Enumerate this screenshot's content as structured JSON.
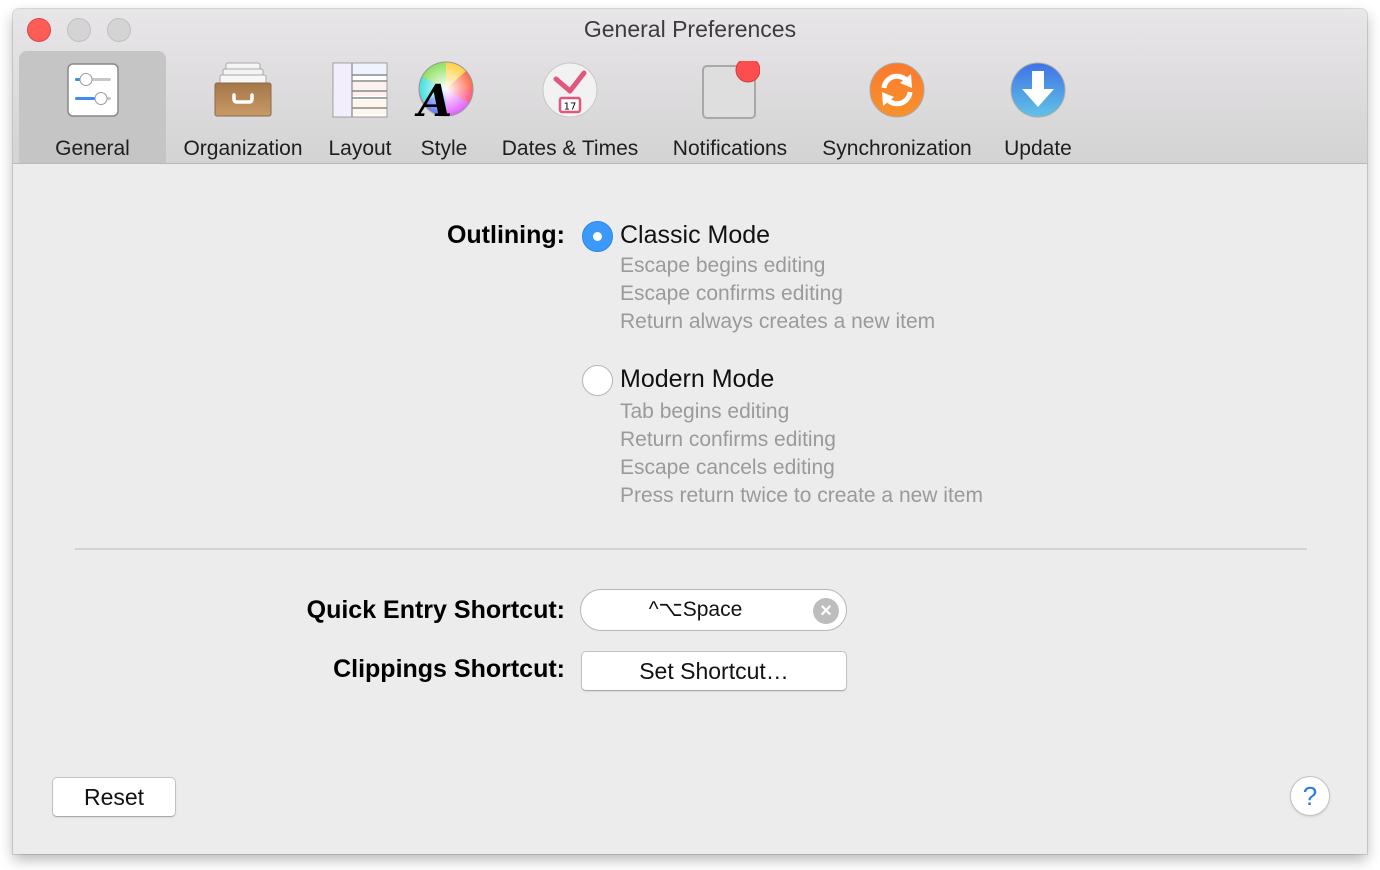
{
  "window": {
    "title": "General Preferences",
    "controls": [
      "close",
      "minimize",
      "zoom"
    ]
  },
  "toolbar": {
    "selected": "General",
    "items": [
      {
        "label": "General",
        "icon": "sliders-icon"
      },
      {
        "label": "Organization",
        "icon": "card-drawer-icon"
      },
      {
        "label": "Layout",
        "icon": "layout-grid-icon"
      },
      {
        "label": "Style",
        "icon": "color-wheel-font-icon"
      },
      {
        "label": "Dates & Times",
        "icon": "clock-calendar-icon",
        "badge_text": "17"
      },
      {
        "label": "Notifications",
        "icon": "notification-badge-icon"
      },
      {
        "label": "Synchronization",
        "icon": "sync-icon"
      },
      {
        "label": "Update",
        "icon": "download-arrow-icon"
      }
    ]
  },
  "outlining": {
    "label": "Outlining:",
    "selected": "Classic Mode",
    "options": [
      {
        "title": "Classic Mode",
        "checked": true,
        "descriptions": [
          "Escape begins editing",
          "Escape confirms editing",
          "Return always creates a new item"
        ]
      },
      {
        "title": "Modern Mode",
        "checked": false,
        "descriptions": [
          "Tab begins editing",
          "Return confirms editing",
          "Escape cancels editing",
          "Press return twice to create a new item"
        ]
      }
    ]
  },
  "shortcuts": {
    "quick_entry_label": "Quick Entry Shortcut:",
    "quick_entry_value": "^⌥Space",
    "clippings_label": "Clippings Shortcut:",
    "clippings_button": "Set Shortcut…"
  },
  "footer": {
    "reset_label": "Reset",
    "help_label": "?"
  },
  "colors": {
    "accent": "#3b99fc",
    "close": "#fd5d57",
    "help_text": "#2a7be4",
    "description_text": "#9a9a9a"
  }
}
